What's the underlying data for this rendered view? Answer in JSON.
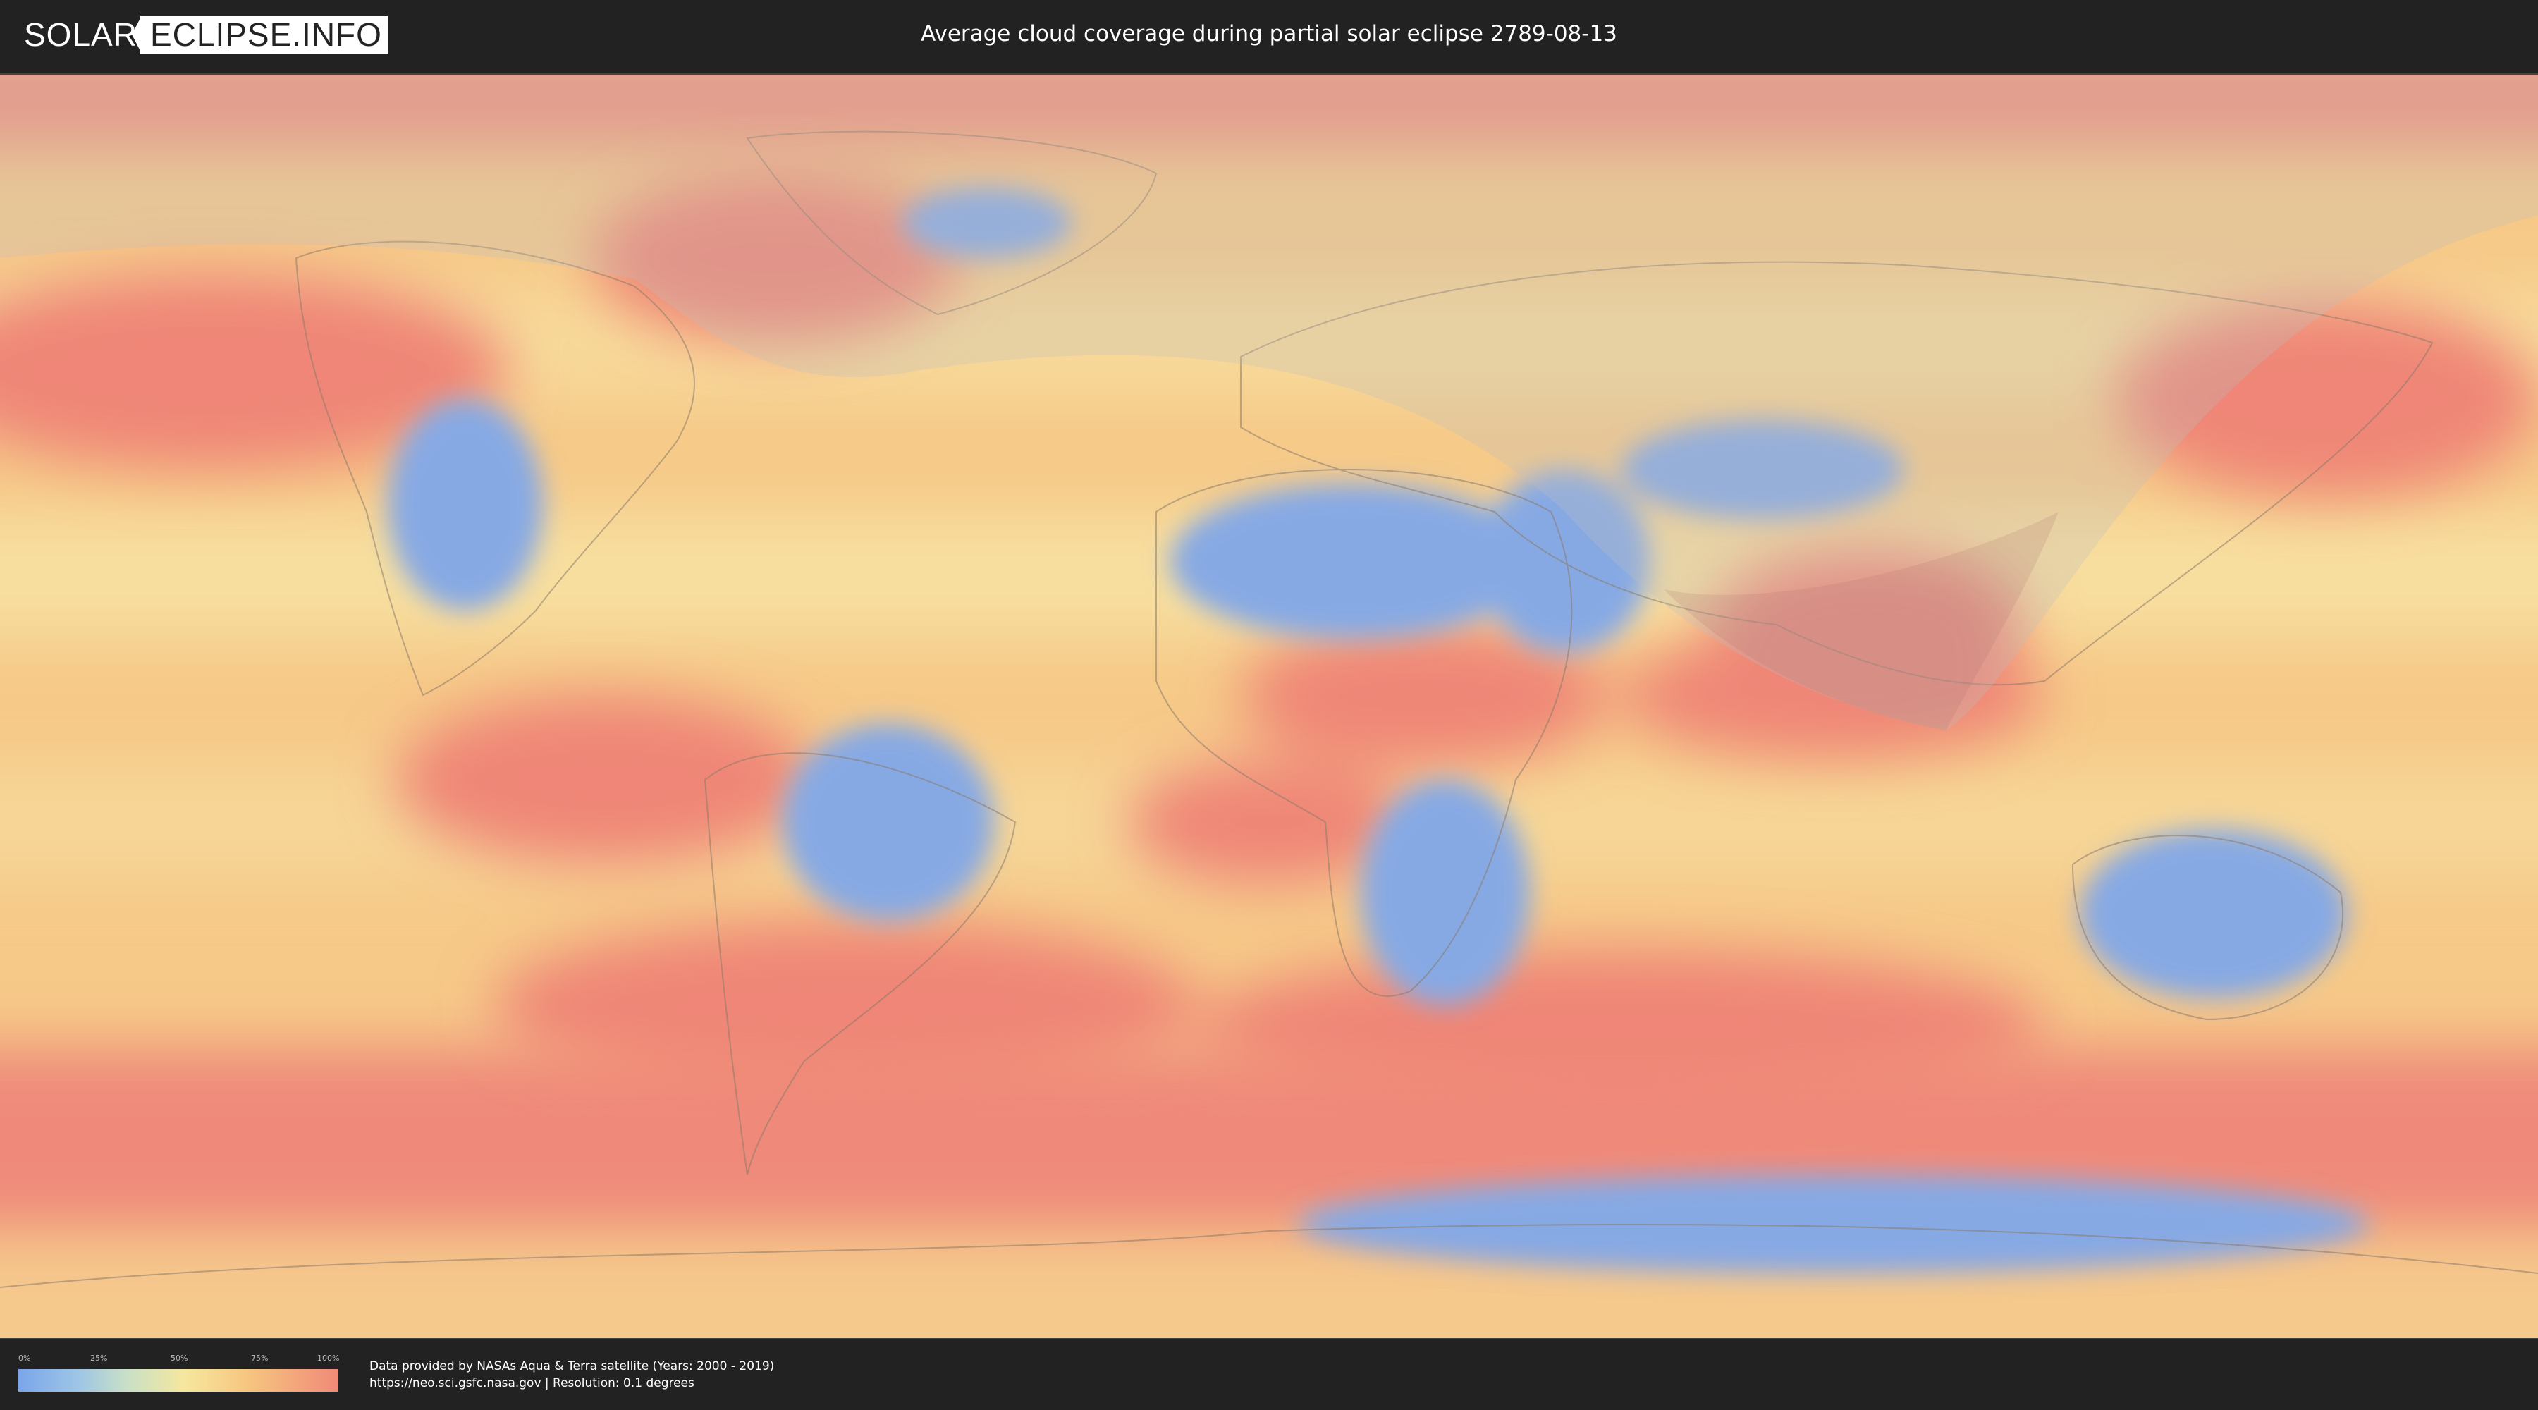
{
  "header": {
    "logo_solar": "SOLAR",
    "logo_eclipse": "ECLIPSE.INFO",
    "title": "Average cloud coverage during partial solar eclipse 2789-08-13"
  },
  "map": {
    "type": "cloud-coverage-world-map",
    "projection": "equirectangular",
    "eclipse_visibility_overlay": true,
    "colors": {
      "clear": "#7aa6ea",
      "low": "#9cc4e6",
      "mid": "#f6e79e",
      "high": "#f6c57f",
      "overcast": "#f08a78",
      "overlay": "#c7c7c7"
    }
  },
  "legend": {
    "ticks": [
      "0%",
      "25%",
      "50%",
      "75%",
      "100%"
    ]
  },
  "credits": {
    "line1": "Data provided by NASAs Aqua & Terra satellite (Years: 2000 - 2019)",
    "line2": "https://neo.sci.gsfc.nasa.gov | Resolution: 0.1 degrees"
  }
}
